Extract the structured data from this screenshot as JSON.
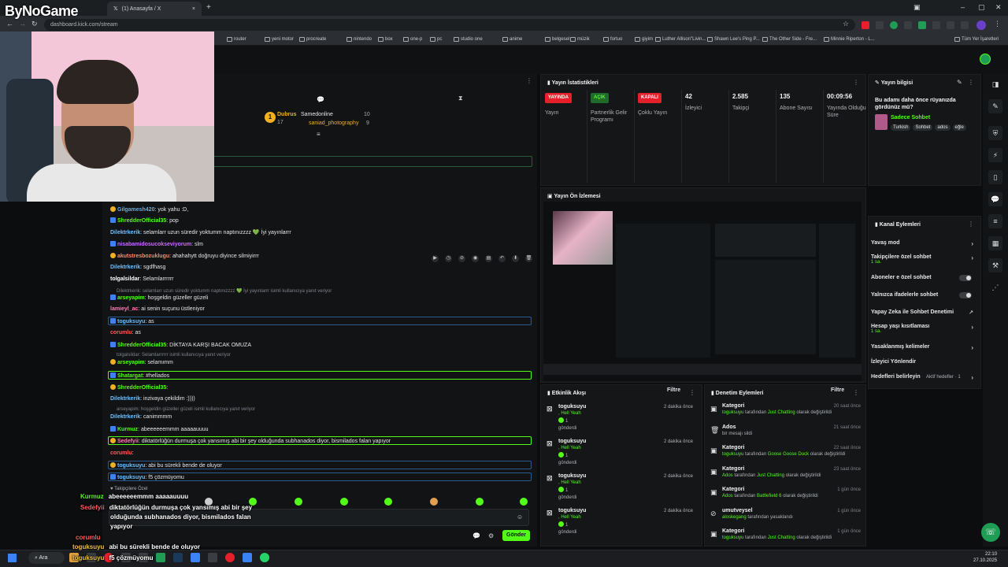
{
  "browser": {
    "tab_title": "(1) Anasayfa / X",
    "url": "dashboard.kick.com/stream",
    "bookmarks": [
      "router",
      "yeni motor",
      "procreate",
      "nintendo",
      "box",
      "one-p",
      "pc",
      "studio one",
      "anime",
      "belgesel",
      "müzik",
      "fortuo",
      "giyim",
      "Luther Allison\"Livin...",
      "Shawn Lee's Ping P...",
      "The Other Side - Fre...",
      "Minnie Riperton - L..."
    ],
    "all_bookmarks": "Tüm Yer İşaretleri"
  },
  "overlay_logo": "ByNoGame",
  "chat": {
    "top_donors": [
      {
        "name": "Dubrus",
        "amount": "17"
      },
      {
        "name": "Samedonline",
        "amount": "10"
      },
      {
        "name": "saniad_photography",
        "amount": "9"
      }
    ],
    "messages": [
      {
        "user": "Gilgamesh420",
        "text": ": yok yahu :D,",
        "color": "#4fb2ff"
      },
      {
        "user": "ShredderOfficial35",
        "text": ": pop",
        "color": "#53fc18"
      },
      {
        "user": "Dilektrkerik",
        "text": ": selamlarr uzun süredir yoktumm naptınızzzz 💚 İyi yayınlarrr",
        "color": "#6ec0ff"
      },
      {
        "user": "nisabamidosucokseviyorum",
        "text": ": slm",
        "color": "#c86bff"
      },
      {
        "user": "akutstresbozuklugu",
        "text": ": ahahahytt doğruyu diyince silmiyirrr",
        "color": "#ff8a65"
      },
      {
        "user": "Dilektrkerik",
        "text": ": sgdfhasg",
        "color": "#6ec0ff"
      },
      {
        "user": "tolgalsildar",
        "text": ": Selamlarrrrrr",
        "color": "#ffffff"
      },
      {
        "user": "arseyapim",
        "text": ": hoşgeldin güzeller güzeli",
        "color": "#53fc18"
      },
      {
        "user": "lamieyl_ac",
        "text": ": ai senin suçunu üstleniyor",
        "color": "#ff7eb6"
      },
      {
        "user": "toguksuyu",
        "text": ": as",
        "color": "#6ec0ff"
      },
      {
        "user": "corumlu",
        "text": ": as",
        "color": "#ff5b5b"
      },
      {
        "user": "ShredderOfficial35",
        "text": ": DİKTAYA KARŞI BACAK OMUZA",
        "color": "#53fc18"
      },
      {
        "user": "arseyapim",
        "text": ": selamımm",
        "color": "#53fc18"
      },
      {
        "user": "Shatargat",
        "text": ": #hellados",
        "color": "#53fc18"
      },
      {
        "user": "ShredderOfficial35",
        "text": ":",
        "color": "#53fc18"
      },
      {
        "user": "Dilektrkerik",
        "text": ": inzivaya çekildim :))))",
        "color": "#6ec0ff"
      },
      {
        "user": "Dilektrkerik",
        "text": ": canimmmm",
        "color": "#6ec0ff"
      },
      {
        "user": "Kurmuz",
        "text": ": abeeeeeemmm aaaaauuuu",
        "color": "#53fc18"
      },
      {
        "user": "Sedefyii",
        "text": ": diktatörlüğün durmuşa çok yansımış abi bir şey olduğunda subhanados diyor, bismilados falan yapıyor",
        "color": "#ff7eb6"
      },
      {
        "user": "corumlu",
        "text": ":",
        "color": "#ff5b5b"
      },
      {
        "user": "toguksuyu",
        "text": ": abi bu sürekli bende de oluyor",
        "color": "#6ec0ff"
      },
      {
        "user": "toguksuyu",
        "text": ": f5 çözmüyomu",
        "color": "#6ec0ff"
      }
    ],
    "replies": [
      "Dilektrkerik: selamlarr uzun süredir yoktumm naptınızzzz 💚 İyi yayınlarrr isimli kullanıcıya yanıt veriyor",
      "tolgalsildar: Selamlarrrrrr isimli kullanıcıya yanıt veriyor",
      "arseyapim: hoşgeldin güzeller güzeli isimli kullanıcıya yanıt veriyor"
    ],
    "followers_only_label": "Takipçilere Özel",
    "send_label": "Gönder"
  },
  "overlay_chat": [
    {
      "user": "Kurmuz",
      "text": "abeeeeeemmm aaaaauuuu",
      "color": "#53fc18"
    },
    {
      "user": "Sedefyii",
      "text": "diktatörlüğün durmuşa çok yansımış abi bir şey",
      "color": "#ff5b5b"
    },
    {
      "user": "",
      "text": "olduğunda subhanados diyor, bismilados falan",
      "color": "#ffffff"
    },
    {
      "user": "",
      "text": "yapıyor",
      "color": "#ffffff"
    },
    {
      "user": "corumlu",
      "text": "",
      "color": "#ff5b5b"
    },
    {
      "user": "toguksuyu",
      "text": "abi bu sürekli bende de oluyor",
      "color": "#f0c040"
    },
    {
      "user": "toguksuyu",
      "text": "f5 çözmüyomu",
      "color": "#f0c040"
    }
  ],
  "stats": {
    "title": "Yayın İstatistikleri",
    "items": [
      {
        "pill": "YAYINDA",
        "label": "Yayın",
        "pill_color": "#e5202a"
      },
      {
        "pill": "AÇIK",
        "label": "Partnerlik Gelir Programı",
        "pill_color": "#1f6b2c"
      },
      {
        "pill": "KAPALI",
        "label": "Çoklu Yayın",
        "pill_color": "#e5202a"
      },
      {
        "num": "42",
        "label": "İzleyici"
      },
      {
        "num": "2.585",
        "label": "Takipçi"
      },
      {
        "num": "135",
        "label": "Abone Sayısı"
      },
      {
        "num": "00:09:56",
        "label": "Yayında Olduğu Süre"
      }
    ]
  },
  "stream_info": {
    "title": "Yayın bilgisi",
    "stream_title": "Bu adamı daha önce rüyanızda gördünüz mü?",
    "category": "Sadece Sohbet",
    "tags": [
      "Turkish",
      "Sohbet",
      "ados",
      "eğle"
    ]
  },
  "preview": {
    "title": "Yayın Ön İzlemesi"
  },
  "channel_actions": {
    "title": "Kanal Eylemleri",
    "items": [
      {
        "label": "Yavaş mod",
        "sub": "",
        "control": "chevron"
      },
      {
        "label": "Takipçilere özel sohbet",
        "sub": "1 sa.",
        "control": "chevron"
      },
      {
        "label": "Aboneler e özel sohbet",
        "sub": "",
        "control": "toggle"
      },
      {
        "label": "Yalnızca ifadelerle sohbet",
        "sub": "",
        "control": "toggle"
      },
      {
        "label": "Yapay Zeka ile Sohbet Denetimi",
        "sub": "",
        "control": "external"
      },
      {
        "label": "Hesap yaşı kısıtlaması",
        "sub": "1 sa.",
        "control": "chevron"
      },
      {
        "label": "Yasaklanmış kelimeler",
        "sub": "",
        "control": "chevron"
      },
      {
        "label": "İzleyici Yönlendir",
        "sub": "",
        "control": "none"
      },
      {
        "label": "Hedefleri belirleyin",
        "sub": "",
        "control": "goal",
        "extra": "Aktif hedefler · 1"
      }
    ]
  },
  "activity": {
    "title": "Etkinlik Akışı",
    "filter": "Filtre",
    "items": [
      {
        "user": "toguksuyu",
        "msg": ", Hell Yeah",
        "count": "1",
        "sent": "gönderdi",
        "time": "2 dakika önce"
      },
      {
        "user": "toguksuyu",
        "msg": ", Hell Yeah",
        "count": "1",
        "sent": "gönderdi",
        "time": "2 dakika önce"
      },
      {
        "user": "toguksuyu",
        "msg": ", Hell Yeah",
        "count": "1",
        "sent": "gönderdi",
        "time": "2 dakika önce"
      },
      {
        "user": "toguksuyu",
        "msg": ", Hell Yeah",
        "count": "1",
        "sent": "gönderdi",
        "time": "2 dakika önce"
      }
    ]
  },
  "moderation": {
    "title": "Denetim Eylemleri",
    "filter": "Filtre",
    "items": [
      {
        "head": "Kategori",
        "actor": "toguksuyu",
        "mid": " tarafından ",
        "target": "Just Chatting",
        "tail": " olarak değiştirildi",
        "time": "20 saat önce"
      },
      {
        "head": "Ados",
        "actor": "",
        "mid": "bir mesajı sildi",
        "target": "",
        "tail": "",
        "time": "21 saat önce"
      },
      {
        "head": "Kategori",
        "actor": "toguksuyu",
        "mid": " tarafından ",
        "target": "Goose Goose Duck",
        "tail": " olarak değiştirildi",
        "time": "22 saat önce"
      },
      {
        "head": "Kategori",
        "actor": "Ados",
        "mid": " tarafından ",
        "target": "Just Chatting",
        "tail": " olarak değiştirildi",
        "time": "23 saat önce"
      },
      {
        "head": "Kategori",
        "actor": "Ados",
        "mid": " tarafından ",
        "target": "Battlefield 6",
        "tail": " olarak değiştirildi",
        "time": "1 gün önce"
      },
      {
        "head": "umutveysel",
        "actor": "aloskegang",
        "mid": " tarafından yasaklandı",
        "target": "",
        "tail": "",
        "time": "1 gün önce"
      },
      {
        "head": "Kategori",
        "actor": "toguksuyu",
        "mid": " tarafından ",
        "target": "Just Chatting",
        "tail": " olarak değiştirildi",
        "time": "1 gün önce"
      }
    ]
  },
  "taskbar": {
    "search": "Ara",
    "time": "22:10",
    "date": "27.10.2025"
  },
  "colors": {
    "accent": "#53fc18",
    "live": "#e5202a",
    "bg": "#0b0d0e",
    "panel": "#141618"
  }
}
